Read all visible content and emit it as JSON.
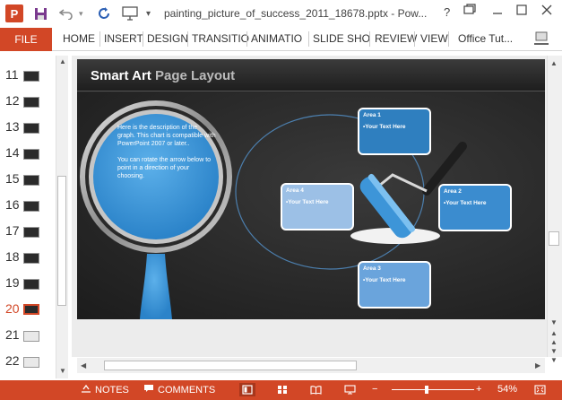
{
  "window": {
    "title": "painting_picture_of_success_2011_18678.pptx - Pow...",
    "app_logo": "P",
    "help": "?",
    "icons": [
      "save-icon",
      "undo-icon",
      "redo-icon",
      "presenter-icon",
      "customize-icon",
      "help-icon",
      "restore-icon",
      "minimize-icon",
      "maximize-icon",
      "close-icon"
    ]
  },
  "ribbon": {
    "file": "FILE",
    "tabs": [
      "HOME",
      "INSERT",
      "DESIGN",
      "TRANSITIO",
      "ANIMATIO",
      "SLIDE SHO",
      "REVIEW",
      "VIEW"
    ],
    "user": "Office Tut..."
  },
  "thumbnails": [
    {
      "num": "11",
      "active": false
    },
    {
      "num": "12",
      "active": false
    },
    {
      "num": "13",
      "active": false
    },
    {
      "num": "14",
      "active": false
    },
    {
      "num": "15",
      "active": false
    },
    {
      "num": "16",
      "active": false
    },
    {
      "num": "17",
      "active": false
    },
    {
      "num": "18",
      "active": false
    },
    {
      "num": "19",
      "active": false
    },
    {
      "num": "20",
      "active": true
    },
    {
      "num": "21",
      "active": false
    },
    {
      "num": "22",
      "active": false
    }
  ],
  "slide": {
    "title_main": "Smart Art",
    "title_sub": "Page Layout",
    "description_1": "Here is the description of the graph. This chart is compatible with PowerPoint 2007 or later..",
    "description_2": "You can rotate the arrow below to point in a direction of your choosing.",
    "areas": [
      {
        "label": "Area 1",
        "text": "•Your Text Here",
        "color": "#2f7fbf"
      },
      {
        "label": "Area 2",
        "text": "•Your Text Here",
        "color": "#3b8ccf"
      },
      {
        "label": "Area 3",
        "text": "•Your Text Here",
        "color": "#6aa4dc"
      },
      {
        "label": "Area 4",
        "text": "•Your Text Here",
        "color": "#9cc0e6"
      }
    ]
  },
  "status": {
    "notes": "NOTES",
    "comments": "COMMENTS",
    "zoom": "54%",
    "zoom_minus": "−",
    "zoom_plus": "+"
  },
  "colors": {
    "accent": "#d24726",
    "paint_blue": "#3d95d8"
  }
}
